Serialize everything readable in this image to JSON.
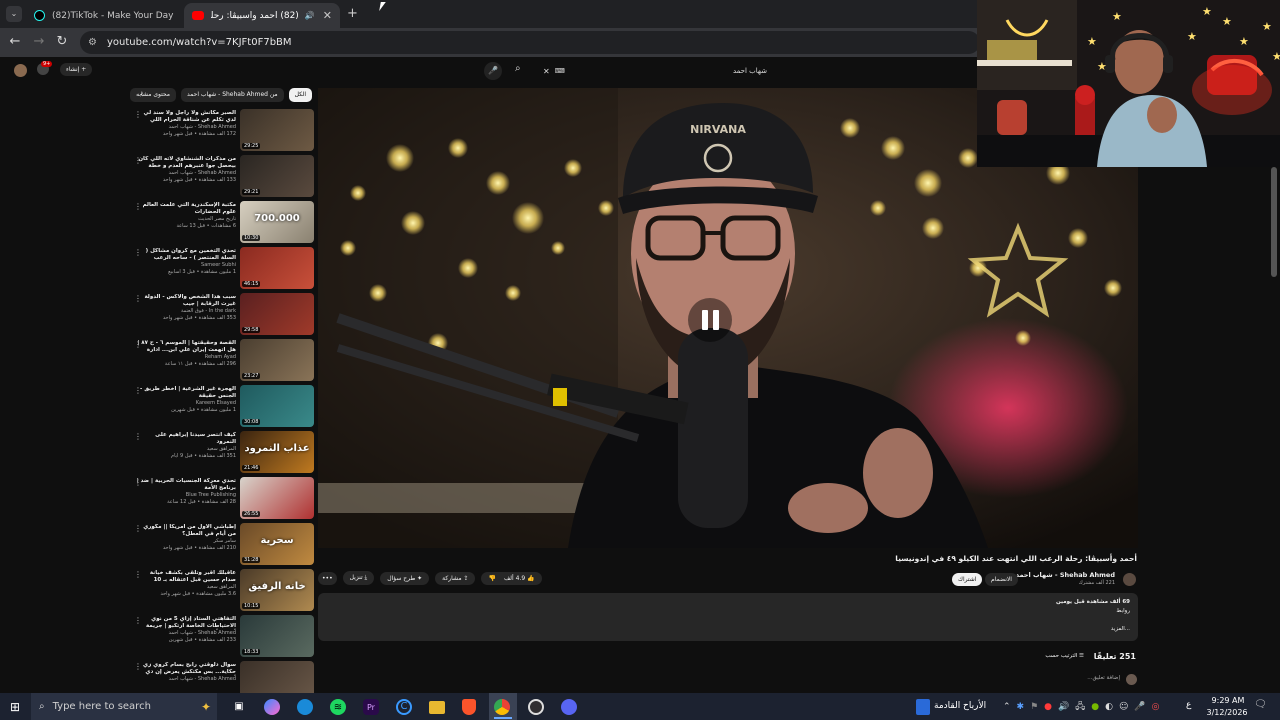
{
  "browser": {
    "tabs": [
      {
        "title": "(82)TikTok - Make Your Day",
        "active": false
      },
      {
        "title": "(82) أحمد وأسبيڤا: رحلة الرعـ",
        "active": true
      }
    ],
    "new_tab": "+",
    "url": "youtube.com/watch?v=7KJFt0F7bBM"
  },
  "youtube": {
    "create_label": "إنشاء",
    "notif_badge": "9+",
    "search_query": "شهاب احمد",
    "chips": [
      "الكل",
      "من Shehab Ahmed - شهاب احمد",
      "محتوى مشابه"
    ],
    "related": [
      {
        "title": "الصبر مكانش ولا راجل ولا سند لي لدي تكلم عن شناقة الحرام اللي حصوت العاشق مكلة",
        "channel": "Shehab Ahmed - شهاب احمد",
        "stats": "172 ألف مشاهدة • قبل شهر واحد",
        "duration": "29:25",
        "thumb_text": "",
        "c1": "#3a3128",
        "c2": "#6e5a44"
      },
      {
        "title": "من مذكرات الشنشاوي لاته اللي كان بيحصل جوا عنبرهم العدم و خطة لسجن اشتر معنا...",
        "channel": "Shehab Ahmed - شهاب احمد",
        "stats": "133 ألف مشاهدة • قبل شهر واحد",
        "duration": "29:21",
        "thumb_text": "",
        "c1": "#2a2622",
        "c2": "#5a4a3e"
      },
      {
        "title": "مكتبة الإسكندرية التي علّمت العالم علوم الحضارات",
        "channel": "تاريخ مصر الحديث",
        "stats": "6 مشاهدات • قبل 13 ساعة",
        "duration": "10:30",
        "thumb_text": "700.000",
        "c1": "#d6cfc0",
        "c2": "#8a8170"
      },
      {
        "title": "تحدي التخمين مع كروان مشاكل ( السلة المنتصر ) - ساحه الرعب",
        "channel": "Sameer Subhi",
        "stats": "1 مليون مشاهدة • قبل 3 أسابيع",
        "duration": "46:15",
        "thumb_text": "",
        "c1": "#8a2a20",
        "c2": "#c9503a"
      },
      {
        "title": "سبب هذا الشخص والاكس - الدولة غيرت الرقابة | جيب",
        "channel": "In the dark - فوق العتمة",
        "stats": "353 ألف مشاهدة • قبل شهر واحد",
        "duration": "29:58",
        "thumb_text": "",
        "c1": "#5a2020",
        "c2": "#a03a2a"
      },
      {
        "title": "القصة وحقيقتها | الموسم ٦ - ح ٨٧ | هل اتهمت إيران علي ابن... ادارة قوات...",
        "channel": "Reham Ayad",
        "stats": "296 ألف مشاهدة • قبل ١١ ساعة",
        "duration": "23:27",
        "thumb_text": "",
        "c1": "#4a3e30",
        "c2": "#8a7458"
      },
      {
        "title": "الهجرة غير الشرعية | أخطر طريق - الجنس حقيقة",
        "channel": "Kareem Elsayed",
        "stats": "1 مليون مشاهدة • قبل شهرين",
        "duration": "30:08",
        "thumb_text": "",
        "c1": "#1f5a5e",
        "c2": "#3a8a8a"
      },
      {
        "title": "كيف انتصر سيدنا إبراهيم على النمرود",
        "channel": "المراهق سعيد",
        "stats": "351 ألف مشاهدة • قبل 9 أيام",
        "duration": "21:46",
        "thumb_text": "عذاب النمرود",
        "c1": "#3a2410",
        "c2": "#c07a20"
      },
      {
        "title": "تحدي معركة الجنسيات الحربية | ضد | برنامج الأمة",
        "channel": "Blue Tree Publishing",
        "stats": "28 ألف مشاهدة • قبل 12 ساعة",
        "duration": "26:55",
        "thumb_text": "",
        "c1": "#d8d4cc",
        "c2": "#b03030"
      },
      {
        "title": "إطباشي الأول من أمريكا || مگوري من أيام في العطل؟",
        "channel": "سامر سكر",
        "stats": "210 ألف مشاهدة • قبل شهر واحد",
        "duration": "31:28",
        "thumb_text": "سحرية",
        "c1": "#6a4a28",
        "c2": "#c08a40"
      },
      {
        "title": "عاقبلك أقبر وتلقى بكشف خيانة صدام حسين قبل اعتقاله بـ 10 ساعات",
        "channel": "المراهق سعيد",
        "stats": "3.6 مليون مشاهدة • قبل شهر واحد",
        "duration": "10:15",
        "thumb_text": "خانه الرفيق",
        "c1": "#4a3a28",
        "c2": "#b08a50"
      },
      {
        "title": "التفاهتي الستاذ إزاي 5 من نوي الاحتياطات الخاصة ارتكبو | جريمة أربعت أمريكا كلها",
        "channel": "Shehab Ahmed - شهاب احمد",
        "stats": "233 ألف مشاهدة • قبل شهرين",
        "duration": "18:33",
        "thumb_text": "",
        "c1": "#2a3a3a",
        "c2": "#5a6a60"
      },
      {
        "title": "سوال دلوقتي رابح بسام كروي زي حكاية... بس مكتكش يعرض إن دي أخر رحلة في حيا...",
        "channel": "Shehab Ahmed - شهاب احمد",
        "stats": "",
        "duration": "",
        "thumb_text": "",
        "c1": "#3a3028",
        "c2": "#6a5848"
      }
    ],
    "video": {
      "title": "أحمد وأسبيڤا: رحلة الرعب اللي انتهت عند الكيلو ٤٩ في إندونيسيا",
      "channel": "Shehab Ahmed - شهاب احمد",
      "subs": "221 ألف مشترك",
      "join_label": "الانضمام",
      "subscribe_label": "اشتراك",
      "likes": "4.9 ألف",
      "share_label": "مشاركة",
      "ask_label": "طرح سؤال",
      "download_label": "تنزيل",
      "more_dots": "...",
      "views_line": "69 ألف مشاهدة  قبل يومين",
      "desc_first": "روابط",
      "desc_more": "...المزيد",
      "comments_count": "251 تعليقًا",
      "sort_label": "الترتيب حسب",
      "add_comment": "إضافة تعليق..."
    }
  },
  "taskbar": {
    "search_placeholder": "Type here to search",
    "weather": "الأرباح القادمة",
    "lang": "ع",
    "time": "9:29 AM",
    "date": "3/12/2026"
  }
}
